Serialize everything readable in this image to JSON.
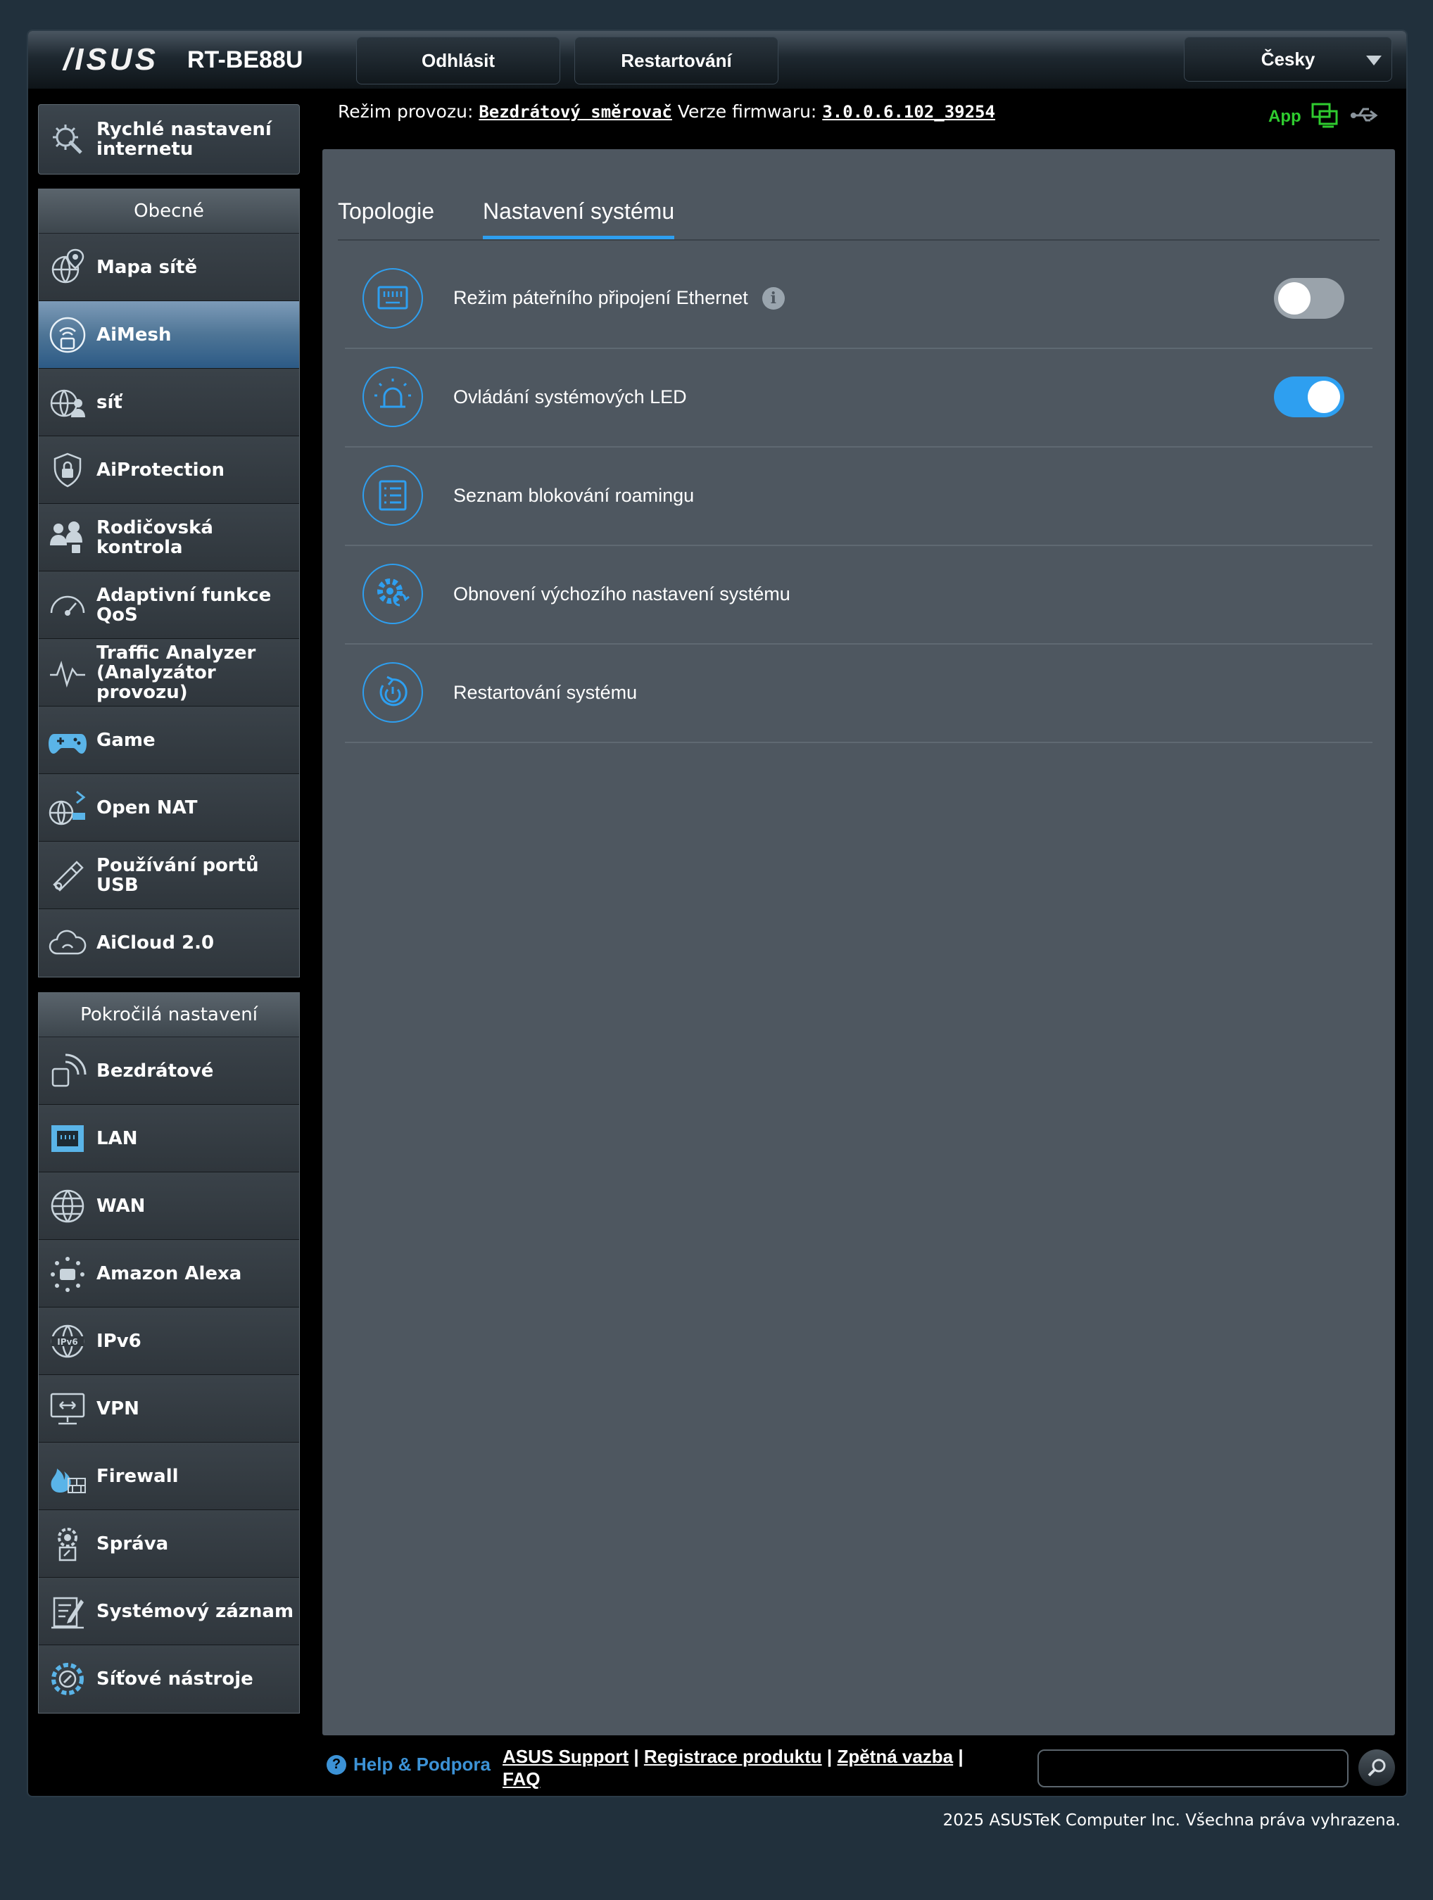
{
  "header": {
    "brand": "/ISUS",
    "model": "RT-BE88U",
    "logout_label": "Odhlásit",
    "restart_label": "Restartování",
    "language": "Česky"
  },
  "quick_setup": {
    "label_line1": "Rychlé nastavení",
    "label_line2": "internetu"
  },
  "general": {
    "title": "Obecné",
    "items": [
      {
        "label": "Mapa sítě",
        "icon": "network-map-icon"
      },
      {
        "label": "AiMesh",
        "icon": "aimesh-icon",
        "active": true
      },
      {
        "label": "síť",
        "icon": "guest-network-icon"
      },
      {
        "label": "AiProtection",
        "icon": "shield-lock-icon"
      },
      {
        "label": "Rodičovská kontrola",
        "icon": "parental-control-icon"
      },
      {
        "label_line1": "Adaptivní funkce",
        "label_line2": "QoS",
        "icon": "speedometer-icon"
      },
      {
        "label_line1": "Traffic Analyzer",
        "label_line2": "(Analyzátor",
        "label_line3": "provozu)",
        "icon": "traffic-analyzer-icon"
      },
      {
        "label": "Game",
        "icon": "gamepad-icon"
      },
      {
        "label": "Open NAT",
        "icon": "open-nat-icon"
      },
      {
        "label": "Používání portů USB",
        "icon": "usb-icon"
      },
      {
        "label": "AiCloud 2.0",
        "icon": "cloud-icon"
      }
    ]
  },
  "advanced": {
    "title": "Pokročilá nastavení",
    "items": [
      {
        "label": "Bezdrátové",
        "icon": "wireless-icon"
      },
      {
        "label": "LAN",
        "icon": "lan-icon"
      },
      {
        "label": "WAN",
        "icon": "globe-icon"
      },
      {
        "label": "Amazon Alexa",
        "icon": "alexa-icon"
      },
      {
        "label": "IPv6",
        "icon": "ipv6-icon"
      },
      {
        "label": "VPN",
        "icon": "vpn-icon"
      },
      {
        "label": "Firewall",
        "icon": "firewall-icon"
      },
      {
        "label": "Správa",
        "icon": "admin-icon"
      },
      {
        "label": "Systémový záznam",
        "icon": "system-log-icon"
      },
      {
        "label": "Síťové nástroje",
        "icon": "network-tools-icon"
      }
    ]
  },
  "status": {
    "mode_label": "Režim provozu:",
    "mode_value": "Bezdrátový směrovač",
    "fw_label": "Verze firmwaru:",
    "fw_value": "3.0.0.6.102_39254",
    "app_label": "App"
  },
  "tabs": [
    {
      "label": "Topologie",
      "active": false
    },
    {
      "label": "Nastavení systému",
      "active": true
    }
  ],
  "settings": [
    {
      "label": "Režim páteřního připojení Ethernet",
      "icon": "ethernet-port-icon",
      "toggle": false,
      "info": true
    },
    {
      "label": "Ovládání systémových LED",
      "icon": "led-alarm-icon",
      "toggle": true
    },
    {
      "label": "Seznam blokování roamingu",
      "icon": "list-icon"
    },
    {
      "label": "Obnovení výchozího nastavení systému",
      "icon": "gear-reset-icon"
    },
    {
      "label": "Restartování systému",
      "icon": "power-restart-icon"
    }
  ],
  "footer": {
    "help_label": "Help & Podpora",
    "link_support": "ASUS Support",
    "link_register": "Registrace produktu",
    "link_feedback": "Zpětná vazba",
    "link_faq": "FAQ",
    "separator": "|",
    "copyright": "2025 ASUSTeK Computer Inc. Všechna práva vyhrazena."
  },
  "colors": {
    "accent": "#2e9ff0",
    "panel": "#4e5760",
    "active_menu": "#4e7596",
    "app_green": "#2fcc2f"
  }
}
